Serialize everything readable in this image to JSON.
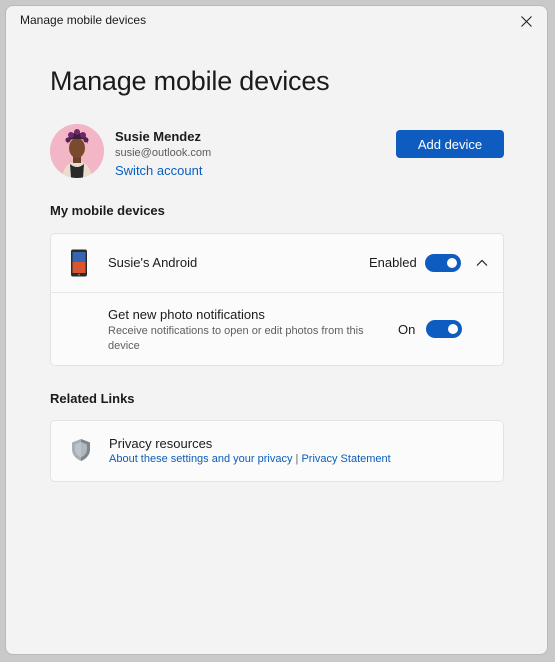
{
  "window": {
    "title": "Manage mobile devices"
  },
  "page": {
    "title": "Manage mobile devices"
  },
  "account": {
    "name": "Susie Mendez",
    "email": "susie@outlook.com",
    "switch_label": "Switch account"
  },
  "actions": {
    "add_device_label": "Add device"
  },
  "devices_section": {
    "heading": "My mobile devices",
    "devices": [
      {
        "name": "Susie's Android",
        "status_label": "Enabled",
        "enabled": true,
        "expanded": true,
        "settings": [
          {
            "title": "Get new photo notifications",
            "description": "Receive notifications to open or edit photos from this device",
            "state_label": "On",
            "on": true
          }
        ]
      }
    ]
  },
  "related_links": {
    "heading": "Related Links",
    "items": [
      {
        "title": "Privacy resources",
        "links": [
          "About these settings and your privacy",
          "Privacy Statement"
        ],
        "separator": "|"
      }
    ]
  },
  "icons": {
    "close": "close-icon",
    "phone": "phone-icon",
    "chevron": "chevron-up-icon",
    "shield": "shield-icon"
  },
  "colors": {
    "accent": "#0f5cc0",
    "link": "#0a5ebd",
    "avatar_bg": "#f3b6c6"
  }
}
